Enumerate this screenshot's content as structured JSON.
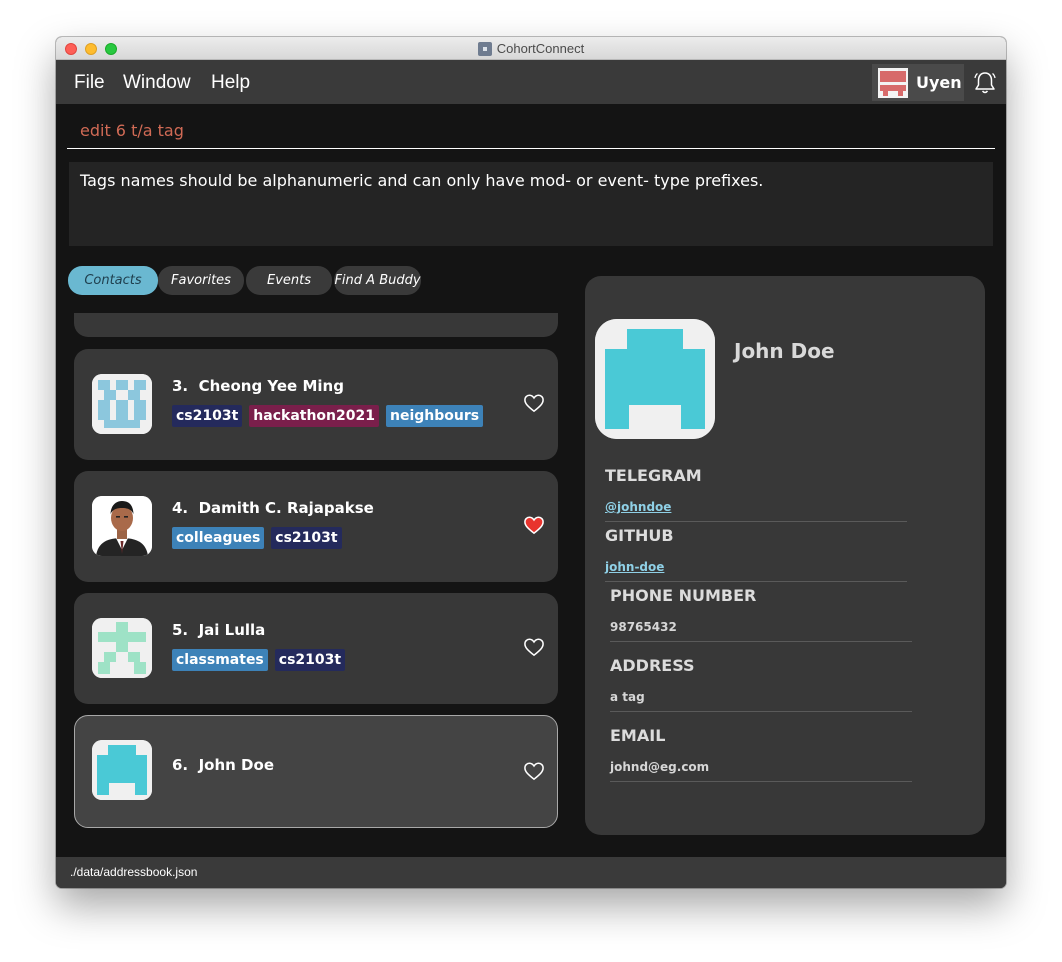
{
  "window": {
    "title": "CohortConnect"
  },
  "menu": {
    "file": "File",
    "window": "Window",
    "help": "Help"
  },
  "user": {
    "name": "Uyen"
  },
  "command": {
    "text": "edit 6 t/a tag"
  },
  "result": {
    "text": "Tags names should be alphanumeric and can only have mod- or event- type prefixes."
  },
  "tabs": [
    "Contacts",
    "Favorites",
    "Events",
    "Find A Buddy"
  ],
  "contacts": [
    {
      "index": "3.",
      "name": "Cheong Yee Ming",
      "tags": [
        "cs2103t",
        "hackathon2021",
        "neighbours"
      ],
      "favorite": false
    },
    {
      "index": "4.",
      "name": "Damith C. Rajapakse",
      "tags": [
        "colleagues",
        "cs2103t"
      ],
      "favorite": true
    },
    {
      "index": "5.",
      "name": "Jai Lulla",
      "tags": [
        "classmates",
        "cs2103t"
      ],
      "favorite": false
    },
    {
      "index": "6.",
      "name": "John Doe",
      "tags": [],
      "favorite": false
    }
  ],
  "detail": {
    "name": "John Doe",
    "telegram_label": "TELEGRAM",
    "telegram": "@johndoe",
    "github_label": "GITHUB",
    "github": "john-doe",
    "phone_label": "PHONE NUMBER",
    "phone": "98765432",
    "address_label": "ADDRESS",
    "address": "a tag",
    "email_label": "EMAIL",
    "email": "johnd@eg.com"
  },
  "status": {
    "path": "./data/addressbook.json"
  },
  "colors": {
    "tag_module": "#242a5c",
    "tag_event": "#7a1f4b",
    "tag_group": "#3d82b8",
    "accent_tab": "#6ab8d1",
    "command_text": "#d06a55",
    "heart_active": "#e8342e"
  }
}
